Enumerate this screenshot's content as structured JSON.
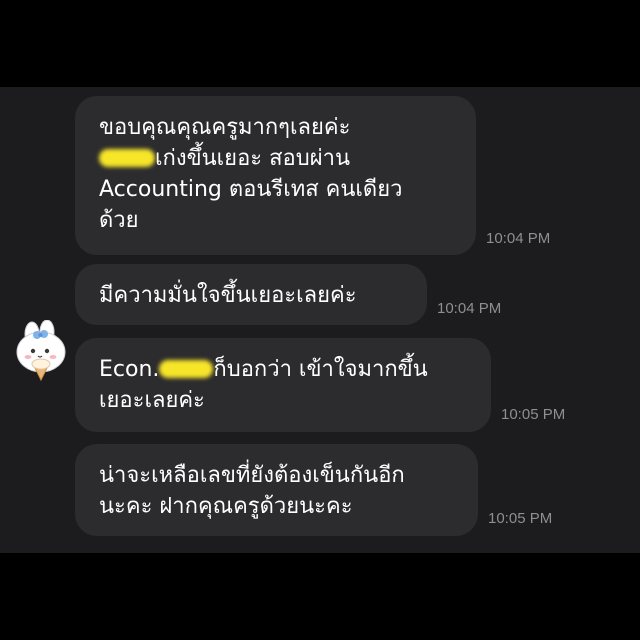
{
  "messages": [
    {
      "lines": [
        "ขอบคุณคุณครูมากๆเลยค่ะ",
        "เก่งขึ้นเยอะ สอบผ่าน",
        "Accounting ตอนรีเทส คนเดียว",
        "ด้วย"
      ],
      "time": "10:04 PM"
    },
    {
      "lines": [
        "มีความมั่นใจขึ้นเยอะเลยค่ะ"
      ],
      "time": "10:04 PM"
    },
    {
      "line1_prefix": "Econ.",
      "line1_suffix": "ก็บอกว่า เข้าใจมากขึ้น",
      "line2": "เยอะเลยค่ะ",
      "time": "10:05 PM"
    },
    {
      "lines": [
        "น่าจะเหลือเลขที่ยังต้องเข็นกันอีก",
        "นะคะ ฝากคุณครูด้วยนะคะ"
      ],
      "time": "10:05 PM"
    }
  ],
  "colors": {
    "background": "#000000",
    "chat_background": "#1c1c1e",
    "bubble": "#2c2c2e",
    "text": "#ffffff",
    "timestamp": "#8e8e93",
    "redaction": "#f7e52a"
  },
  "avatar_icon": "bunny-sticker-icon"
}
